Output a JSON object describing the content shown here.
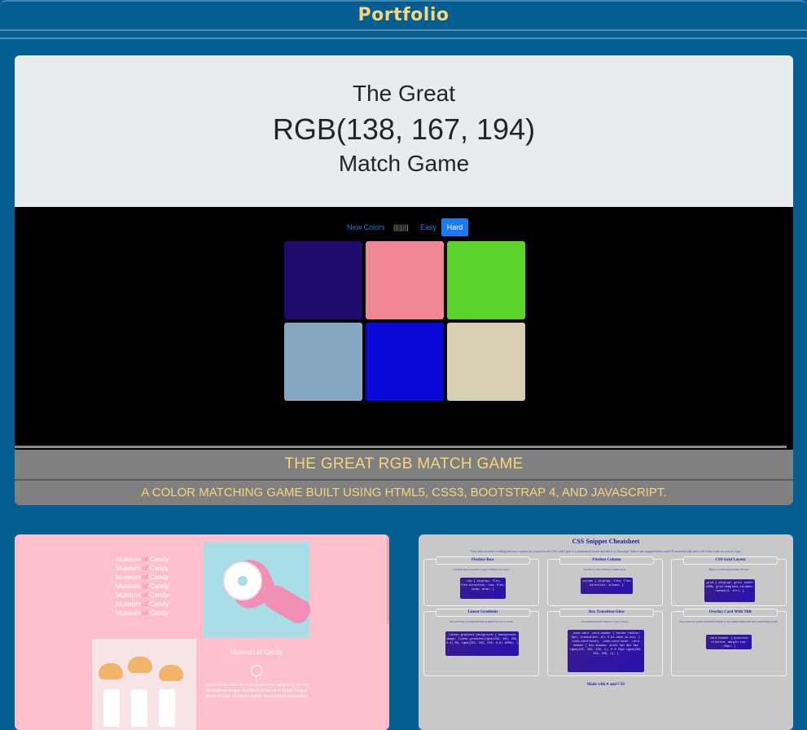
{
  "header": {
    "title": "Portfolio"
  },
  "featured": {
    "hero_line1": "The Great",
    "hero_line2": "RGB(138, 167, 194)",
    "hero_line3": "Match Game",
    "buttons": {
      "new_colors": "New Colors",
      "message": "||||||||",
      "easy": "Easy",
      "hard": "Hard"
    },
    "squares": [
      "#200b6c",
      "#ef8794",
      "#5ad32c",
      "#86a7c2",
      "#0a08d6",
      "#d6cfb1"
    ],
    "caption": "THE GREAT RGB MATCH GAME",
    "description": "A COLOR MATCHING GAME BUILT USING HTML5, CSS3, BOOTSTRAP 4, AND JAVASCRIPT."
  },
  "candy": {
    "titles": [
      "Museum of Candy",
      "Museum of Candy",
      "Museum of Candy",
      "Museum of Candy",
      "Museum of Candy",
      "Museum of Candy",
      "Museum of Candy"
    ],
    "word_museum": "Museum ",
    "word_of": "of ",
    "word_candy": "Candy",
    "subtitle": "Museum of Candy",
    "paragraph": "Lorem ipsum dolor sit amet consectetur adipiscing elit sed do eiusmod tempor incididunt ut labore et dolore magna aliqua ut enim ad minim veniam quis nostrud exercitation"
  },
  "cheatsheet": {
    "title": "CSS Snippet Cheatsheet",
    "intro": "Ever have trouble recalling the exact syntax for your favorite CSS code? give it a permanent home and add it to this page! Select any snippet below and it'll automatically select all of the code for you to copy.",
    "cards": [
      {
        "title": "Flexbox Row",
        "desc": "Use these three properties to create a Flexbox row layout.",
        "code": ".row { display: flex; flex-direction: row; flex-wrap: wrap; }"
      },
      {
        "title": "Flexbox Column",
        "desc": "Use this to create a Flexbox column layout.",
        "code": ".column { display: flex; flex-direction: column; }"
      },
      {
        "title": "CSS Grid Layout",
        "desc": "Build a 3 column layout using CSS Grid",
        "code": ".grid { display: grid; width: 100%; grid-template-columns: repeat(3, 1fr); }"
      },
      {
        "title": "Linear Gradients",
        "desc": "This will create a background linear gradient from top to bottom.",
        "code": ".linear-gradient-background { background-image: linear-gradient(rgba(232, 102, 236, 0.3) 0%, rgba(232, 102, 236, 0.6) 100%); }"
      },
      {
        "title": "Box Transition Glow",
        "desc": "Use transition and box shadow to glow on hover.",
        "code": ".code-card .card-header { border-radius: 8px; transition: all 0.5s ease-in-out; } .code-card:hover, .code-card:hover .card-header { box-shadow: inset 0px 0px 8px rgba(232, 102, 236, 1), 0 0 15px rgba(232, 102, 236, 1); }"
      },
      {
        "title": "Overlay Card With Title",
        "desc": "Use position properties and negative margin to raise element higher than their natural starting point.",
        "code": ".card-header { position: relative; margin-top: -20px; }"
      }
    ],
    "footer": "Made with ♥ and CSS"
  }
}
